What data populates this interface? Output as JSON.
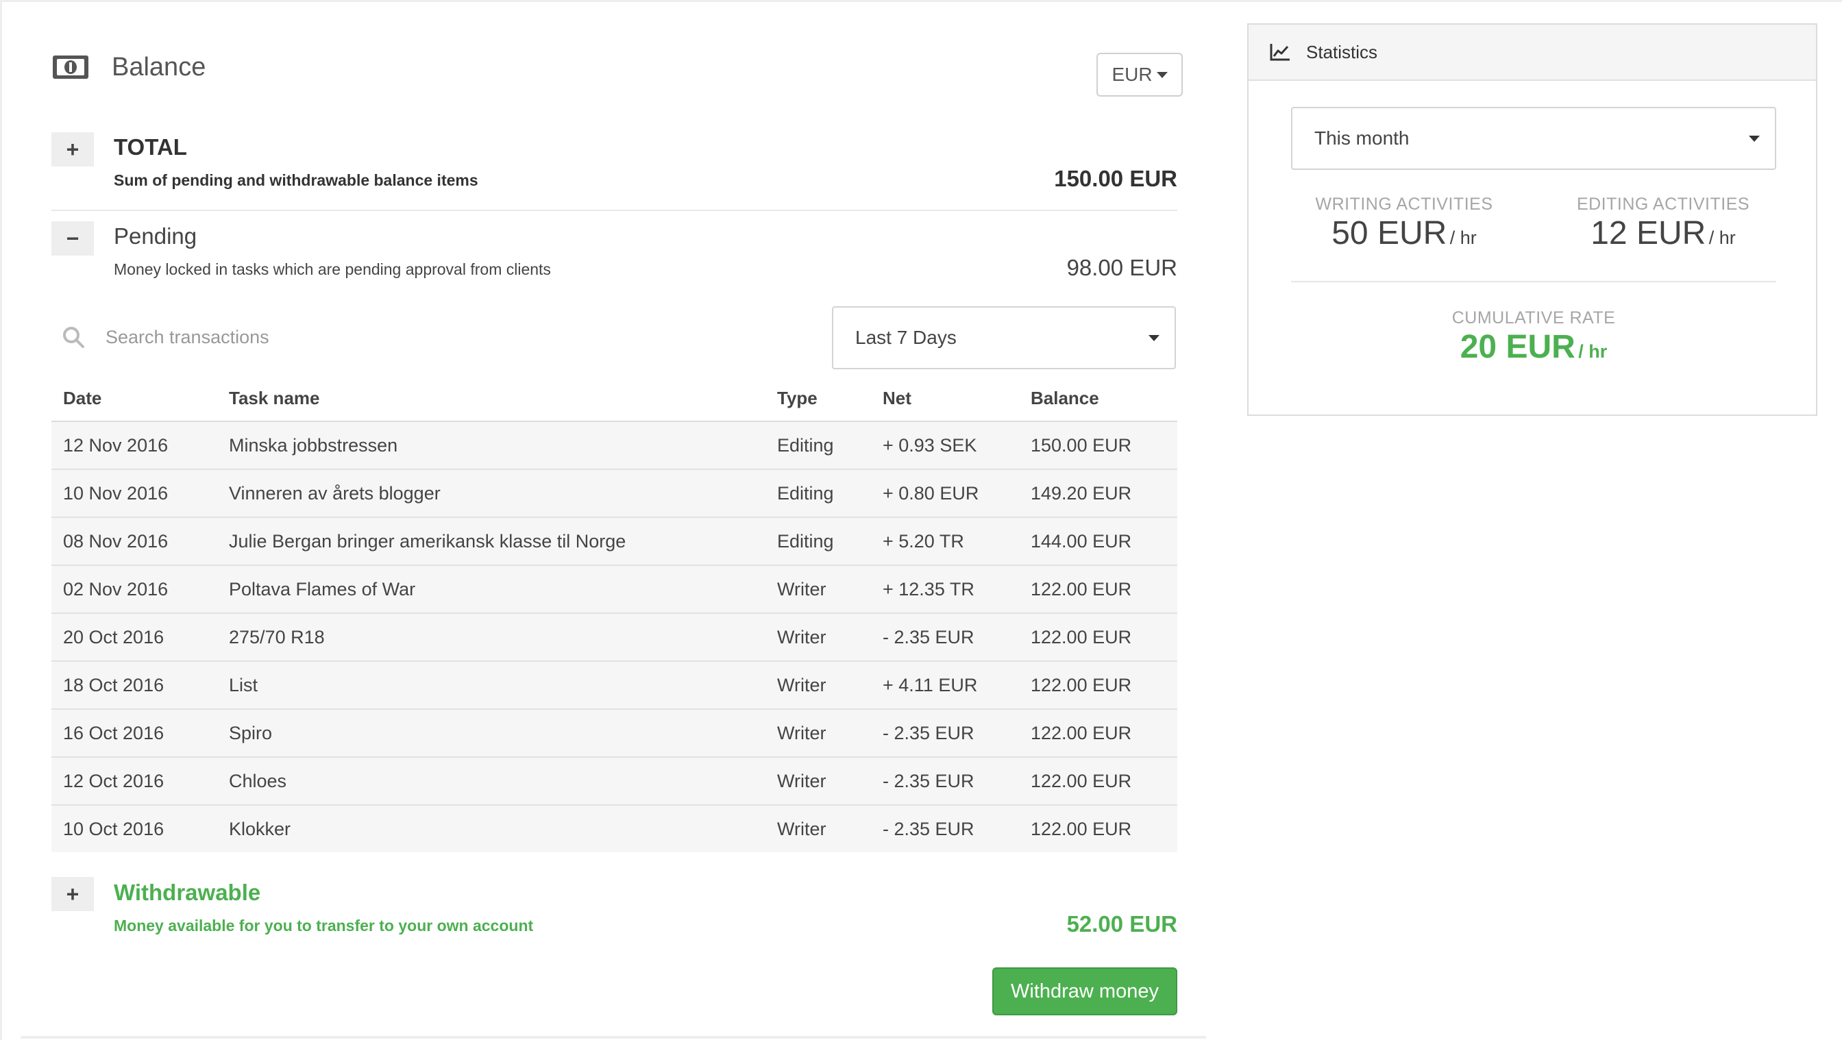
{
  "balance": {
    "title": "Balance",
    "currency": "EUR",
    "total": {
      "toggle": "+",
      "title": "TOTAL",
      "description": "Sum of pending and withdrawable balance items",
      "amount": "150.00 EUR"
    },
    "pending": {
      "toggle": "−",
      "title": "Pending",
      "description": "Money locked in tasks which are pending approval from clients",
      "amount": "98.00 EUR"
    },
    "search": {
      "placeholder": "Search transactions",
      "value": ""
    },
    "range": "Last 7 Days",
    "table": {
      "headers": [
        "Date",
        "Task name",
        "Type",
        "Net",
        "Balance"
      ],
      "rows": [
        [
          "12 Nov 2016",
          "Minska jobbstressen",
          "Editing",
          "+ 0.93 SEK",
          "150.00 EUR"
        ],
        [
          "10 Nov 2016",
          "Vinneren av årets blogger",
          "Editing",
          "+ 0.80 EUR",
          "149.20 EUR"
        ],
        [
          "08 Nov 2016",
          "Julie Bergan bringer amerikansk klasse til Norge",
          "Editing",
          "+ 5.20 TR",
          "144.00 EUR"
        ],
        [
          "02 Nov 2016",
          "Poltava Flames of War",
          "Writer",
          "+ 12.35 TR",
          "122.00 EUR"
        ],
        [
          "20 Oct 2016",
          "275/70 R18",
          "Writer",
          "- 2.35 EUR",
          "122.00 EUR"
        ],
        [
          "18 Oct 2016",
          "List",
          "Writer",
          "+ 4.11 EUR",
          "122.00 EUR"
        ],
        [
          "16 Oct 2016",
          "Spiro",
          "Writer",
          "- 2.35 EUR",
          "122.00 EUR"
        ],
        [
          "12 Oct 2016",
          "Chloes",
          "Writer",
          "- 2.35 EUR",
          "122.00 EUR"
        ],
        [
          "10 Oct 2016",
          "Klokker",
          "Writer",
          "- 2.35 EUR",
          "122.00 EUR"
        ]
      ]
    },
    "withdrawable": {
      "toggle": "+",
      "title": "Withdrawable",
      "description": "Money available for you to transfer to your own account",
      "amount": "52.00 EUR"
    },
    "withdraw_button": "Withdraw money"
  },
  "statistics": {
    "title": "Statistics",
    "period": "This month",
    "writing": {
      "label": "WRITING ACTIVITIES",
      "value": "50 EUR",
      "unit": "/ hr"
    },
    "editing": {
      "label": "EDITING ACTIVITIES",
      "value": "12 EUR",
      "unit": "/ hr"
    },
    "cumulative": {
      "label": "CUMULATIVE RATE",
      "value": "20 EUR",
      "unit": "/ hr"
    }
  },
  "colors": {
    "accent": "#4cb050",
    "text": "#444444",
    "muted": "#a6a6a6",
    "row_bg": "#f6f6f6"
  }
}
